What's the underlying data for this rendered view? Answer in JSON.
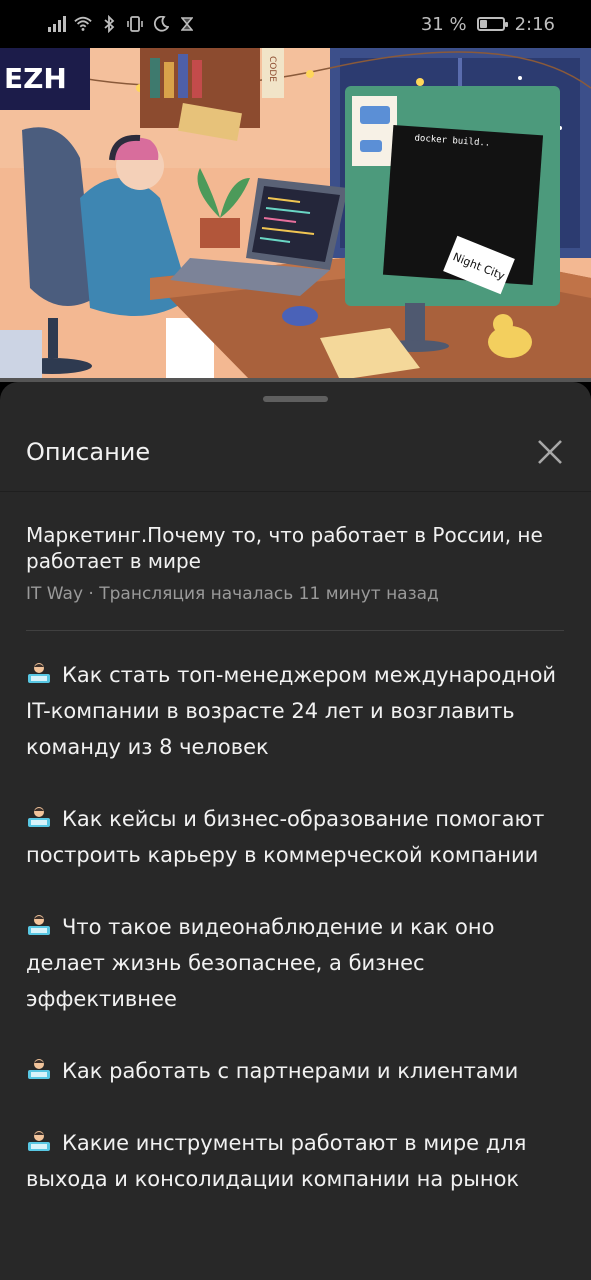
{
  "status_bar": {
    "battery_percent_text": "31 %",
    "battery_level": 0.31,
    "time": "2:16",
    "icons": [
      "signal-icon",
      "wifi-icon",
      "bluetooth-icon",
      "vibrate-icon",
      "moon-icon",
      "hourglass-icon"
    ]
  },
  "video": {
    "thumbnail_text": [
      "docker build..",
      "Night City",
      "CODE",
      "EZH"
    ],
    "progress_fraction": 0.0,
    "accent": "#e3171b"
  },
  "sheet": {
    "title": "Описание",
    "close_icon": "close-icon"
  },
  "video_info": {
    "title": "Маркетинг.Почему то, что работает в России, не работает в мире",
    "channel": "IT Way",
    "separator": " · ",
    "stream_status": "Трансляция началась 11 минут назад"
  },
  "description": {
    "emoji_icon": "technologist-emoji",
    "items": [
      "Как стать топ-менеджером международной IT-компании в возрасте 24 лет и возглавить команду из 8 человек",
      "Как кейсы и бизнес-образование помогают построить карьеру в коммерческой компании",
      "Что такое видеонаблюдение и как оно делает жизнь безопаснее, а бизнес эффективнее",
      "Как работать с партнерами и клиентами",
      "Какие инструменты работают в мире для выхода и консолидации компании на рынок"
    ]
  }
}
